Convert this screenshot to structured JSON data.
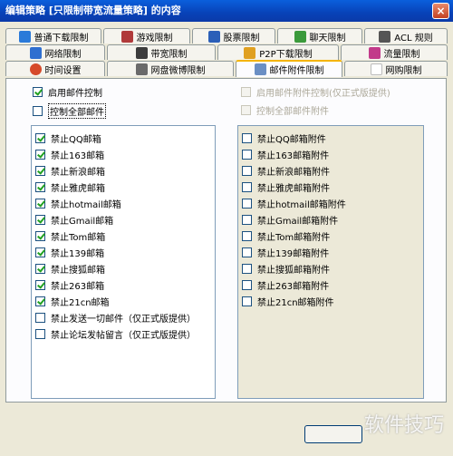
{
  "window": {
    "title": "编辑策略 [只限制带宽流量策略] 的内容",
    "close_label": "×"
  },
  "tabs_row1": [
    {
      "label": "普通下载限制",
      "icon": "download-icon",
      "color": "#2a7ad9"
    },
    {
      "label": "游戏限制",
      "icon": "game-icon",
      "color": "#b03a3a"
    },
    {
      "label": "股票限制",
      "icon": "stock-icon",
      "color": "#2b5fb8"
    },
    {
      "label": "聊天限制",
      "icon": "chat-icon",
      "color": "#3b9a3b"
    },
    {
      "label": "ACL 规则",
      "icon": "acl-icon",
      "color": "#555555"
    }
  ],
  "tabs_row2": [
    {
      "label": "网络限制",
      "icon": "network-icon",
      "color": "#2f6fd0"
    },
    {
      "label": "带宽限制",
      "icon": "bandwidth-icon",
      "color": "#3c3c3c"
    },
    {
      "label": "P2P下载限制",
      "icon": "p2p-icon",
      "color": "#e0a020"
    },
    {
      "label": "流量限制",
      "icon": "traffic-icon",
      "color": "#c23a8a"
    }
  ],
  "tabs_row3": [
    {
      "label": "时间设置",
      "icon": "clock-icon",
      "color": "#d64a2a"
    },
    {
      "label": "网盘微博限制",
      "icon": "cloud-icon",
      "color": "#6a6a6a"
    },
    {
      "label": "邮件附件限制",
      "icon": "mail-icon",
      "color": "#6b8fc4"
    },
    {
      "label": "网购限制",
      "icon": "shop-icon",
      "color": "#ffffff"
    }
  ],
  "left": {
    "enable_label": "启用邮件控制",
    "control_all_label": "控制全部邮件",
    "items": [
      {
        "label": "禁止QQ邮箱",
        "checked": true
      },
      {
        "label": "禁止163邮箱",
        "checked": true
      },
      {
        "label": "禁止新浪邮箱",
        "checked": true
      },
      {
        "label": "禁止雅虎邮箱",
        "checked": true
      },
      {
        "label": "禁止hotmail邮箱",
        "checked": true
      },
      {
        "label": "禁止Gmail邮箱",
        "checked": true
      },
      {
        "label": "禁止Tom邮箱",
        "checked": true
      },
      {
        "label": "禁止139邮箱",
        "checked": true
      },
      {
        "label": "禁止搜狐邮箱",
        "checked": true
      },
      {
        "label": "禁止263邮箱",
        "checked": true
      },
      {
        "label": "禁止21cn邮箱",
        "checked": true
      },
      {
        "label": "禁止发送一切邮件（仅正式版提供）",
        "checked": false
      },
      {
        "label": "禁止论坛发帖留言（仅正式版提供）",
        "checked": false
      }
    ]
  },
  "right": {
    "enable_label": "启用邮件附件控制(仅正式版提供)",
    "control_all_label": "控制全部邮件附件",
    "items": [
      {
        "label": "禁止QQ邮箱附件"
      },
      {
        "label": "禁止163邮箱附件"
      },
      {
        "label": "禁止新浪邮箱附件"
      },
      {
        "label": "禁止雅虎邮箱附件"
      },
      {
        "label": "禁止hotmail邮箱附件"
      },
      {
        "label": "禁止Gmail邮箱附件"
      },
      {
        "label": "禁止Tom邮箱附件"
      },
      {
        "label": "禁止139邮箱附件"
      },
      {
        "label": "禁止搜狐邮箱附件"
      },
      {
        "label": "禁止263邮箱附件"
      },
      {
        "label": "禁止21cn邮箱附件"
      }
    ]
  },
  "watermark": "软件技巧"
}
